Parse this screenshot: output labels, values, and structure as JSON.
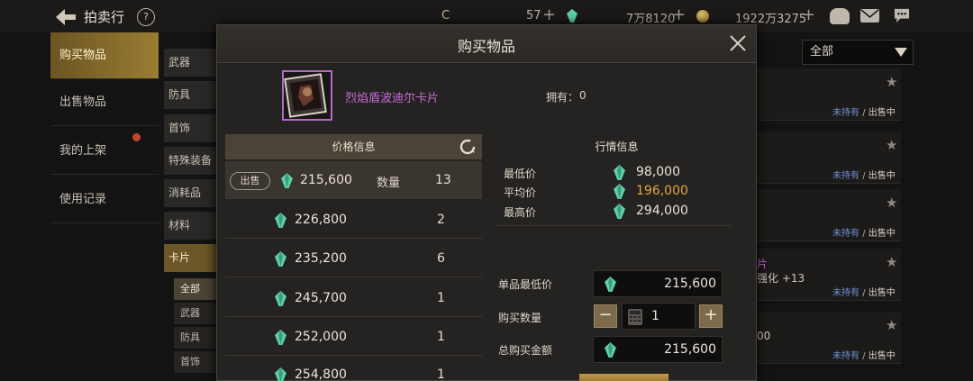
{
  "topbar": {
    "title": "拍卖行",
    "help": "?",
    "currency_symbol": "C",
    "res1": "57",
    "res2": "7万8120",
    "res3": "1922万3275",
    "plus": "+"
  },
  "leftnav": {
    "tabs": [
      {
        "label": "购买物品",
        "active": true
      },
      {
        "label": "出售物品",
        "active": false
      },
      {
        "label": "我的上架",
        "active": false
      },
      {
        "label": "使用记录",
        "active": false
      }
    ]
  },
  "categories": {
    "items": [
      "武器",
      "防具",
      "首饰",
      "特殊装备",
      "消耗品",
      "材料",
      "卡片"
    ],
    "active": "卡片",
    "sub": [
      "全部",
      "武器",
      "防具",
      "首饰"
    ],
    "sub_active": "全部"
  },
  "filter": {
    "selected": "全部"
  },
  "listing": {
    "status_not_owned": "未持有",
    "status_sep": "/",
    "status_on_sale": "出售中",
    "frag_name": "片",
    "frag_enhance": "强化 +13",
    "frag_price": "00"
  },
  "modal": {
    "title": "购买物品",
    "item_name": "烈焰盾波迪尔卡片",
    "owned_label": "拥有：",
    "owned_value": "0",
    "price_header": "价格信息",
    "market_header": "行情信息",
    "sell_label": "出售",
    "qty_label": "数量",
    "price_rows": [
      {
        "price": "215,600",
        "qty": "13"
      },
      {
        "price": "226,800",
        "qty": "2"
      },
      {
        "price": "235,200",
        "qty": "6"
      },
      {
        "price": "245,700",
        "qty": "1"
      },
      {
        "price": "252,000",
        "qty": "1"
      },
      {
        "price": "254,800",
        "qty": "1"
      }
    ],
    "market": {
      "min_label": "最低价",
      "min_value": "98,000",
      "avg_label": "平均价",
      "avg_value": "196,000",
      "max_label": "最高价",
      "max_value": "294,000"
    },
    "buy": {
      "unit_min_label": "单品最低价",
      "unit_min_value": "215,600",
      "qty_label": "购买数量",
      "qty_value": "1",
      "minus": "−",
      "plus": "+",
      "total_label": "总购买金额",
      "total_value": "215,600"
    }
  },
  "colors": {
    "accent_gold": "#9a7c33",
    "rarity_purple": "#c86ad8",
    "avg_gold": "#e1a73c",
    "gem_green": "#5fd1a8"
  }
}
